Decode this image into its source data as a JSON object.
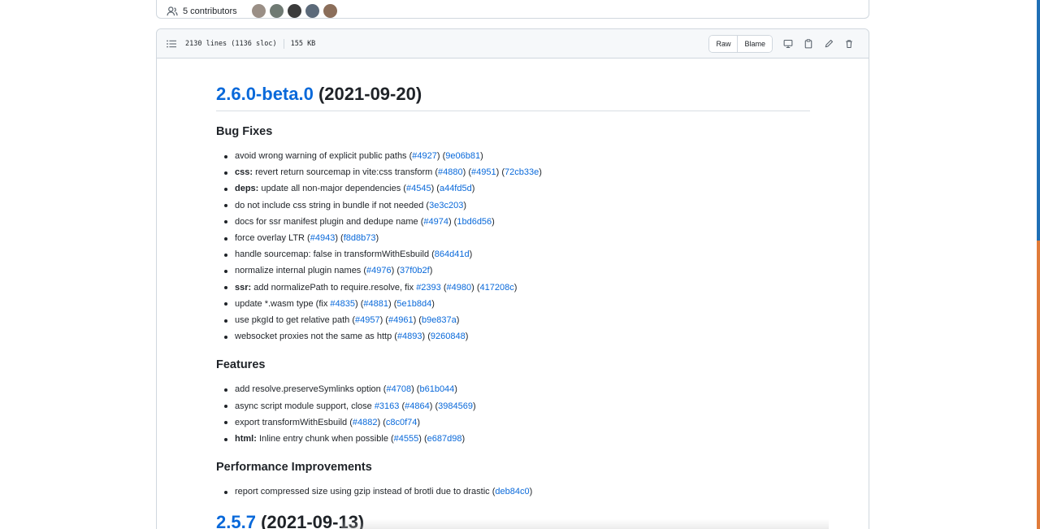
{
  "contributors": {
    "label": "5 contributors",
    "avatar_colors": [
      "#9a8f86",
      "#6f7a73",
      "#3b3b3b",
      "#5c6a7a",
      "#8b6e5a"
    ]
  },
  "file": {
    "lines": "2130 lines (1136 sloc)",
    "size": "155 KB",
    "raw_label": "Raw",
    "blame_label": "Blame",
    "icons": [
      "display-icon",
      "copy-icon",
      "pencil-icon",
      "trash-icon"
    ]
  },
  "release": {
    "version": "2.6.0-beta.0",
    "date": "(2021-09-20)"
  },
  "sections": [
    {
      "title": "Bug Fixes",
      "items": [
        [
          {
            "t": "avoid wrong warning of explicit public paths ("
          },
          {
            "l": "#4927"
          },
          {
            "t": ") ("
          },
          {
            "l": "9e06b81"
          },
          {
            "t": ")"
          }
        ],
        [
          {
            "b": "css:"
          },
          {
            "t": " revert return sourcemap in vite:css transform ("
          },
          {
            "l": "#4880"
          },
          {
            "t": ") ("
          },
          {
            "l": "#4951"
          },
          {
            "t": ") ("
          },
          {
            "l": "72cb33e"
          },
          {
            "t": ")"
          }
        ],
        [
          {
            "b": "deps:"
          },
          {
            "t": " update all non-major dependencies ("
          },
          {
            "l": "#4545"
          },
          {
            "t": ") ("
          },
          {
            "l": "a44fd5d"
          },
          {
            "t": ")"
          }
        ],
        [
          {
            "t": "do not include css string in bundle if not needed ("
          },
          {
            "l": "3e3c203"
          },
          {
            "t": ")"
          }
        ],
        [
          {
            "t": "docs for ssr manifest plugin and dedupe name ("
          },
          {
            "l": "#4974"
          },
          {
            "t": ") ("
          },
          {
            "l": "1bd6d56"
          },
          {
            "t": ")"
          }
        ],
        [
          {
            "t": "force overlay LTR ("
          },
          {
            "l": "#4943"
          },
          {
            "t": ") ("
          },
          {
            "l": "f8d8b73"
          },
          {
            "t": ")"
          }
        ],
        [
          {
            "t": "handle sourcemap: false in transformWithEsbuild ("
          },
          {
            "l": "864d41d"
          },
          {
            "t": ")"
          }
        ],
        [
          {
            "t": "normalize internal plugin names ("
          },
          {
            "l": "#4976"
          },
          {
            "t": ") ("
          },
          {
            "l": "37f0b2f"
          },
          {
            "t": ")"
          }
        ],
        [
          {
            "b": "ssr:"
          },
          {
            "t": " add normalizePath to require.resolve, fix "
          },
          {
            "l": "#2393"
          },
          {
            "t": " ("
          },
          {
            "l": "#4980"
          },
          {
            "t": ") ("
          },
          {
            "l": "417208c"
          },
          {
            "t": ")"
          }
        ],
        [
          {
            "t": "update *.wasm type (fix "
          },
          {
            "l": "#4835"
          },
          {
            "t": ") ("
          },
          {
            "l": "#4881"
          },
          {
            "t": ") ("
          },
          {
            "l": "5e1b8d4"
          },
          {
            "t": ")"
          }
        ],
        [
          {
            "t": "use pkgId to get relative path ("
          },
          {
            "l": "#4957"
          },
          {
            "t": ") ("
          },
          {
            "l": "#4961"
          },
          {
            "t": ") ("
          },
          {
            "l": "b9e837a"
          },
          {
            "t": ")"
          }
        ],
        [
          {
            "t": "websocket proxies not the same as http ("
          },
          {
            "l": "#4893"
          },
          {
            "t": ") ("
          },
          {
            "l": "9260848"
          },
          {
            "t": ")"
          }
        ]
      ]
    },
    {
      "title": "Features",
      "items": [
        [
          {
            "t": "add resolve.preserveSymlinks option ("
          },
          {
            "l": "#4708"
          },
          {
            "t": ") ("
          },
          {
            "l": "b61b044"
          },
          {
            "t": ")"
          }
        ],
        [
          {
            "t": "async script module support, close "
          },
          {
            "l": "#3163"
          },
          {
            "t": " ("
          },
          {
            "l": "#4864"
          },
          {
            "t": ") ("
          },
          {
            "l": "3984569"
          },
          {
            "t": ")"
          }
        ],
        [
          {
            "t": "export transformWithEsbuild ("
          },
          {
            "l": "#4882"
          },
          {
            "t": ") ("
          },
          {
            "l": "c8c0f74"
          },
          {
            "t": ")"
          }
        ],
        [
          {
            "b": "html:"
          },
          {
            "t": " Inline entry chunk when possible ("
          },
          {
            "l": "#4555"
          },
          {
            "t": ") ("
          },
          {
            "l": "e687d98"
          },
          {
            "t": ")"
          }
        ]
      ]
    },
    {
      "title": "Performance Improvements",
      "items": [
        [
          {
            "t": "report compressed size using gzip instead of brotli due to drastic ("
          },
          {
            "l": "deb84c0"
          },
          {
            "t": ")"
          }
        ]
      ]
    }
  ],
  "next_release": {
    "version": "2.5.7",
    "date": "(2021-09-13)"
  },
  "colors": {
    "link": "#0969da",
    "border": "#d0d7de",
    "edge_blue": "#1f6fb5",
    "edge_orange": "#e07b39"
  }
}
